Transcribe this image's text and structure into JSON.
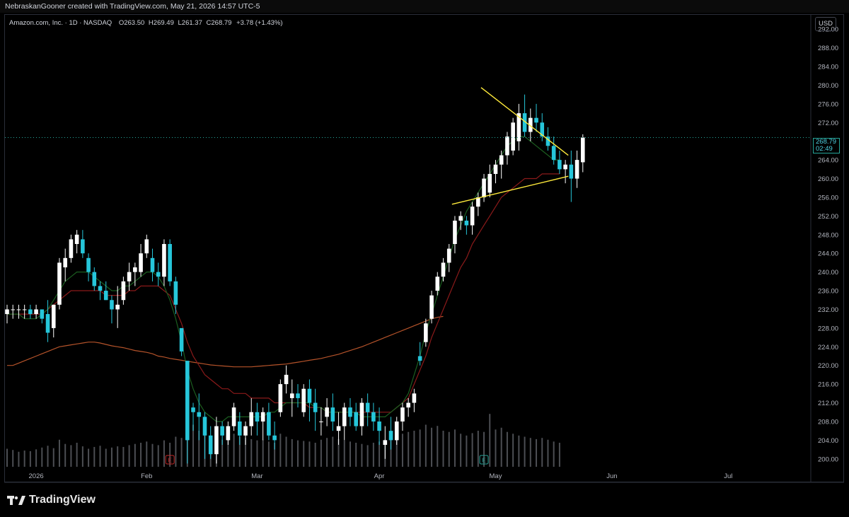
{
  "header": {
    "attribution": "NebraskanGooner created with TradingView.com, May 21, 2026 14:57 UTC-5"
  },
  "legend": {
    "symbol": "Amazon.com, Inc. · 1D · NASDAQ",
    "open_label": "O",
    "open": "263.50",
    "high_label": "H",
    "high": "269.49",
    "low_label": "L",
    "low": "261.37",
    "close_label": "C",
    "close": "268.79",
    "change": "+3.78 (+1.43%)"
  },
  "currency": "USD",
  "last_price": {
    "price": "268.79",
    "countdown": "02:49"
  },
  "footer": {
    "brand": "TradingView"
  },
  "colors": {
    "up_candle": "#ffffff",
    "down_candle": "#26c6da",
    "ma_short": "#1b5e20",
    "ma_mid": "#8b1a1a",
    "ma_long": "#b5532a",
    "trendline": "#ffeb3b",
    "last_price_line": "#26a69a"
  },
  "chart_data": {
    "type": "candlestick",
    "ylim": [
      198,
      294
    ],
    "y_ticks": [
      200,
      204,
      208,
      212,
      216,
      220,
      224,
      228,
      232,
      236,
      240,
      244,
      248,
      252,
      256,
      260,
      264,
      268,
      272,
      276,
      280,
      284,
      288,
      292
    ],
    "y_tick_labels": [
      "200.00",
      "204.00",
      "208.00",
      "212.00",
      "216.00",
      "220.00",
      "224.00",
      "228.00",
      "232.00",
      "236.00",
      "240.00",
      "244.00",
      "248.00",
      "252.00",
      "256.00",
      "260.00",
      "264.00",
      "268.00",
      "272.00",
      "276.00",
      "280.00",
      "284.00",
      "288.00",
      "292.00"
    ],
    "x_labels": [
      {
        "label": "2026",
        "i": 5
      },
      {
        "label": "Feb",
        "i": 24
      },
      {
        "label": "Mar",
        "i": 43
      },
      {
        "label": "Apr",
        "i": 64
      },
      {
        "label": "May",
        "i": 84
      },
      {
        "label": "Jun",
        "i": 104
      },
      {
        "label": "Jul",
        "i": 124
      }
    ],
    "earnings_markers": [
      {
        "label": "E",
        "i": 28,
        "color": "#c62828"
      },
      {
        "label": "E",
        "i": 82,
        "color": "#26a69a"
      }
    ],
    "last_price": 268.79,
    "candles": [
      [
        231,
        233,
        229,
        232
      ],
      [
        232,
        233,
        230,
        232
      ],
      [
        232,
        233,
        230,
        232
      ],
      [
        232,
        233,
        230,
        232
      ],
      [
        232,
        233,
        230,
        231
      ],
      [
        231,
        233,
        230,
        232
      ],
      [
        232,
        232,
        229,
        230
      ],
      [
        231,
        234,
        225,
        227
      ],
      [
        228,
        233,
        226,
        233
      ],
      [
        233,
        243,
        232,
        242
      ],
      [
        241,
        245,
        238,
        243
      ],
      [
        243,
        248,
        242,
        247
      ],
      [
        246,
        249,
        244,
        248
      ],
      [
        247,
        249,
        243,
        244
      ],
      [
        243,
        244,
        238,
        240
      ],
      [
        240,
        241,
        236,
        237
      ],
      [
        237,
        238,
        234,
        236
      ],
      [
        236,
        238,
        234,
        234
      ],
      [
        234,
        235,
        229,
        232
      ],
      [
        232,
        237,
        228,
        233
      ],
      [
        234,
        239,
        233,
        238
      ],
      [
        238,
        242,
        236,
        240
      ],
      [
        240,
        242,
        237,
        241
      ],
      [
        240,
        246,
        239,
        244
      ],
      [
        244,
        248,
        243,
        247
      ],
      [
        243,
        245,
        238,
        240
      ],
      [
        240,
        242,
        237,
        239
      ],
      [
        239,
        247,
        237,
        246
      ],
      [
        246,
        247,
        237,
        238
      ],
      [
        238,
        239,
        231,
        233
      ],
      [
        228,
        226,
        222,
        223
      ],
      [
        221,
        211,
        199,
        204
      ],
      [
        211,
        212,
        206,
        210
      ],
      [
        210,
        214,
        204,
        209
      ],
      [
        209,
        210,
        200,
        205
      ],
      [
        205,
        207,
        200,
        201
      ],
      [
        201,
        209,
        199,
        207
      ],
      [
        207,
        208,
        203,
        205
      ],
      [
        204,
        208,
        203,
        207
      ],
      [
        207,
        212,
        206,
        211
      ],
      [
        208,
        210,
        203,
        205
      ],
      [
        205,
        208,
        203,
        207
      ],
      [
        207,
        213,
        205,
        210
      ],
      [
        210,
        212,
        205,
        208
      ],
      [
        208,
        211,
        204,
        210
      ],
      [
        210,
        212,
        204,
        205
      ],
      [
        205,
        208,
        202,
        204
      ],
      [
        210,
        217,
        209,
        216
      ],
      [
        216,
        220,
        214,
        218
      ],
      [
        213,
        217,
        209,
        214
      ],
      [
        214,
        216,
        211,
        213
      ],
      [
        210,
        216,
        209,
        215
      ],
      [
        215,
        217,
        208,
        212
      ],
      [
        212,
        215,
        206,
        210
      ],
      [
        208,
        211,
        205,
        208
      ],
      [
        209,
        213,
        207,
        211
      ],
      [
        211,
        214,
        206,
        208
      ],
      [
        206,
        210,
        203,
        207
      ],
      [
        207,
        212,
        204,
        211
      ],
      [
        211,
        213,
        207,
        209
      ],
      [
        210,
        212,
        206,
        207
      ],
      [
        207,
        213,
        205,
        212
      ],
      [
        212,
        214,
        207,
        210
      ],
      [
        210,
        212,
        206,
        208
      ],
      [
        208,
        211,
        203,
        206
      ],
      [
        203,
        207,
        200,
        204
      ],
      [
        206,
        209,
        202,
        204
      ],
      [
        204,
        209,
        203,
        208
      ],
      [
        208,
        212,
        206,
        211
      ],
      [
        211,
        213,
        209,
        212
      ],
      [
        212,
        215,
        210,
        214
      ],
      [
        222,
        225,
        220,
        221
      ],
      [
        225,
        230,
        224,
        229
      ],
      [
        230,
        236,
        229,
        235
      ],
      [
        236,
        240,
        235,
        239
      ],
      [
        239,
        243,
        238,
        242
      ],
      [
        242,
        246,
        240,
        245
      ],
      [
        246,
        252,
        244,
        251
      ],
      [
        251,
        253,
        249,
        252
      ],
      [
        251,
        252,
        248,
        250
      ],
      [
        250,
        255,
        248,
        254
      ],
      [
        254,
        257,
        252,
        256
      ],
      [
        256,
        261,
        255,
        260
      ],
      [
        257,
        263,
        256,
        261
      ],
      [
        261,
        264,
        259,
        263
      ],
      [
        263,
        266,
        260,
        265
      ],
      [
        265,
        270,
        263,
        269
      ],
      [
        266,
        273,
        265,
        272
      ]
    ],
    "candles_may": [
      [
        268,
        276,
        266,
        274
      ],
      [
        274,
        278,
        269,
        270
      ],
      [
        270,
        275,
        268,
        273
      ],
      [
        273,
        276,
        270,
        272
      ],
      [
        272,
        274,
        268,
        269
      ],
      [
        269,
        271,
        266,
        267
      ],
      [
        267,
        269,
        263,
        264
      ],
      [
        264,
        266,
        261,
        262
      ],
      [
        262,
        264,
        259,
        263
      ],
      [
        263,
        266,
        255,
        260
      ],
      [
        260,
        266,
        258,
        264
      ],
      [
        263.5,
        269.49,
        261.37,
        268.79
      ]
    ],
    "volume": [
      30,
      28,
      25,
      27,
      26,
      29,
      32,
      35,
      31,
      45,
      38,
      36,
      40,
      34,
      30,
      33,
      35,
      30,
      32,
      34,
      33,
      36,
      38,
      40,
      42,
      38,
      36,
      44,
      40,
      50,
      48,
      100,
      70,
      60,
      55,
      52,
      50,
      45,
      48,
      55,
      50,
      48,
      46,
      44,
      45,
      42,
      40,
      55,
      50,
      46,
      44,
      43,
      42,
      40,
      45,
      48,
      50,
      46,
      44,
      42,
      40,
      38,
      36,
      40,
      42,
      45,
      48,
      50,
      55,
      58,
      60,
      62,
      70,
      65,
      68,
      60,
      58,
      62,
      55,
      52,
      56,
      60,
      58,
      88,
      62,
      65,
      58,
      55,
      52,
      50,
      48,
      46,
      48,
      45,
      42,
      40
    ],
    "ma_short": [
      231,
      231,
      231,
      230,
      230,
      230,
      231,
      232,
      234,
      236,
      238,
      239,
      240,
      240,
      240,
      239,
      238,
      237,
      236,
      236,
      237,
      237,
      238,
      239,
      240,
      240,
      239,
      237,
      234,
      230,
      225,
      219,
      215,
      212,
      210,
      209,
      208,
      208,
      209,
      209,
      209,
      209,
      209,
      209,
      209,
      210,
      210,
      211,
      212,
      212,
      212,
      212,
      212,
      211,
      211,
      210,
      210,
      210,
      210,
      210,
      210,
      209,
      209,
      209,
      209,
      209,
      210,
      211,
      212,
      214,
      218,
      222,
      227,
      231,
      235,
      239,
      243,
      247,
      250,
      253,
      255,
      257,
      259,
      261,
      263,
      265,
      267,
      268,
      269,
      269,
      268,
      267,
      266,
      265,
      264,
      264
    ],
    "ma_mid": [
      231,
      231,
      231,
      231,
      231,
      231,
      231,
      232,
      233,
      234,
      235,
      236,
      236,
      236,
      236,
      236,
      236,
      235,
      235,
      235,
      235,
      236,
      236,
      237,
      237,
      237,
      237,
      236,
      235,
      232,
      229,
      225,
      222,
      220,
      218,
      217,
      216,
      215,
      215,
      214,
      214,
      214,
      213,
      213,
      213,
      213,
      212,
      212,
      212,
      212,
      212,
      212,
      211,
      211,
      211,
      210,
      210,
      210,
      210,
      210,
      210,
      210,
      210,
      210,
      210,
      210,
      210,
      211,
      212,
      213,
      216,
      219,
      222,
      226,
      229,
      232,
      235,
      238,
      241,
      243,
      246,
      248,
      250,
      252,
      254,
      256,
      257,
      258,
      259,
      260,
      260,
      260,
      261,
      261,
      261,
      261
    ],
    "ma_long": [
      220,
      220,
      220.5,
      221,
      221.5,
      222,
      222.5,
      223,
      223.5,
      224,
      224.2,
      224.4,
      224.6,
      224.8,
      225,
      225,
      224.8,
      224.5,
      224.2,
      224,
      223.8,
      223.5,
      223.2,
      223,
      222.8,
      222.5,
      222,
      221.8,
      221.5,
      221.3,
      221.1,
      220.9,
      220.7,
      220.5,
      220.3,
      220.1,
      220,
      219.9,
      219.8,
      219.7,
      219.7,
      219.7,
      219.7,
      219.8,
      219.9,
      220,
      220.1,
      220.2,
      220.3,
      220.5,
      220.7,
      220.9,
      221.1,
      221.3,
      221.5,
      221.8,
      222.1,
      222.4,
      222.8,
      223.2,
      223.6,
      224,
      224.5,
      225,
      225.5,
      226,
      226.5,
      227,
      227.5,
      228,
      228.5,
      229,
      229.5,
      230,
      230.3,
      230.5
    ],
    "trendlines": [
      {
        "x1": 81.5,
        "y1": 279.5,
        "x2": 96.5,
        "y2": 265
      },
      {
        "x1": 76.5,
        "y1": 254.5,
        "x2": 96.5,
        "y2": 260.5
      }
    ]
  }
}
